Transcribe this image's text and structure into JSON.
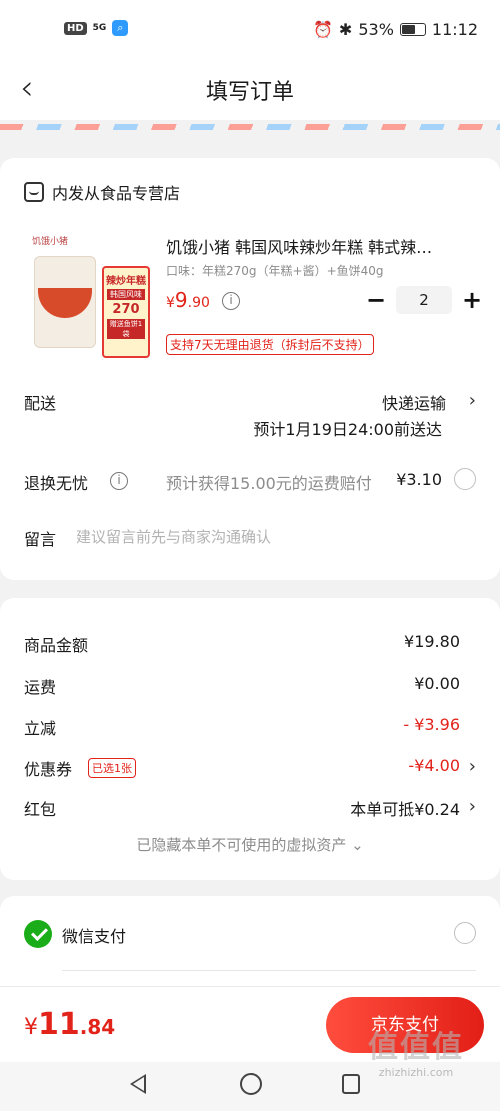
{
  "status_bar": {
    "left_icons": [
      "HD",
      "5G"
    ],
    "battery": "53%",
    "time": "11:12"
  },
  "nav": {
    "title": "填写订单"
  },
  "store": {
    "name": "内发从食品专营店"
  },
  "product": {
    "image_logo": "饥饿小猪",
    "image_box": [
      "辣炒年糕",
      "韩国风味",
      "270",
      "赠送鱼饼1袋"
    ],
    "title": "饥饿小猪 韩国风味辣炒年糕 韩式辣…",
    "spec": "口味：年糕270g（年糕+酱）+鱼饼40g",
    "price_currency": "¥",
    "price_int": "9",
    "price_dec": ".90",
    "quantity": "2",
    "return_policy": "支持7天无理由退货（拆封后不支持）"
  },
  "delivery": {
    "label": "配送",
    "method": "快递运输",
    "eta": "预计1月19日24:00前送达"
  },
  "insurance": {
    "label": "退换无忧",
    "desc": "预计获得15.00元的运费赔付",
    "price": "¥3.10"
  },
  "note": {
    "label": "留言",
    "placeholder": "建议留言前先与商家沟通确认"
  },
  "summary": {
    "goods_label": "商品金额",
    "goods_value": "¥19.80",
    "shipping_label": "运费",
    "shipping_value": "¥0.00",
    "discount_label": "立减",
    "discount_value": "- ¥3.96",
    "coupon_label": "优惠券",
    "coupon_tag": "已选1张",
    "coupon_value": "-¥4.00",
    "redpacket_label": "红包",
    "redpacket_value": "本单可抵¥0.24",
    "hidden_assets": "已隐藏本单不可使用的虚拟资产 ⌄"
  },
  "payment": {
    "wechat_label": "微信支付"
  },
  "bottom": {
    "total_currency": "¥",
    "total_int": "11",
    "total_dec": ".84",
    "pay_button": "京东支付"
  },
  "watermark": {
    "logo": "值",
    "text": "zhizhizhi.com"
  },
  "colors": {
    "accent_red": "#e2231a",
    "wechat_green": "#1aad19"
  }
}
